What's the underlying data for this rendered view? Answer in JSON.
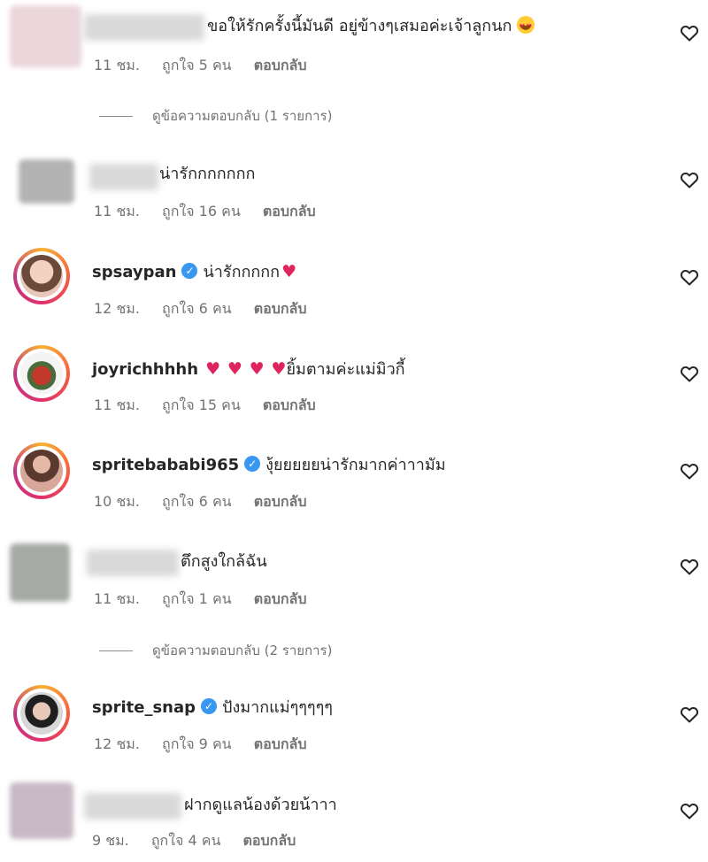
{
  "comments": [
    {
      "text": "ขอให้รักครั้งนี้มันดี อยู่ข้างๆเสมอค่ะเจ้าลูกนก",
      "time": "11 ชม.",
      "likes": "ถูกใจ 5 คน",
      "reply": "ตอบกลับ"
    },
    {
      "text": "น่ารักกกกกกก",
      "time": "11 ชม.",
      "likes": "ถูกใจ 16 คน",
      "reply": "ตอบกลับ"
    },
    {
      "username": "spsaypan",
      "text": "น่ารักกกกก",
      "time": "12 ชม.",
      "likes": "ถูกใจ 6 คน",
      "reply": "ตอบกลับ"
    },
    {
      "username": "joyrichhhhh",
      "text": "ยิ้มตามค่ะแม่มิวกี้",
      "time": "11 ชม.",
      "likes": "ถูกใจ 15 คน",
      "reply": "ตอบกลับ"
    },
    {
      "username": "spritebababi965",
      "text": "งุ้ยยยยยน่ารักมากค่าาามัม",
      "time": "10 ชม.",
      "likes": "ถูกใจ 6 คน",
      "reply": "ตอบกลับ"
    },
    {
      "text": "ตึกสูงใกล้ฉัน",
      "time": "11 ชม.",
      "likes": "ถูกใจ 1 คน",
      "reply": "ตอบกลับ"
    },
    {
      "username": "sprite_snap",
      "text": "ปังมากแม่ๆๆๆๆๆ",
      "time": "12 ชม.",
      "likes": "ถูกใจ 9 คน",
      "reply": "ตอบกลับ"
    },
    {
      "text": "ฝากดูแลน้องด้วยน้าาา",
      "time": "9 ชม.",
      "likes": "ถูกใจ 4 คน",
      "reply": "ตอบกลับ"
    }
  ],
  "view_replies": [
    "ดูข้อความตอบกลับ (1 รายการ)",
    "ดูข้อความตอบกลับ (2 รายการ)"
  ],
  "colors": {
    "verified": "#3897f0",
    "heart": "#e0245e",
    "muted": "#737373"
  },
  "icons": {
    "like": "heart-outline-icon",
    "verified": "verified-badge-icon"
  }
}
